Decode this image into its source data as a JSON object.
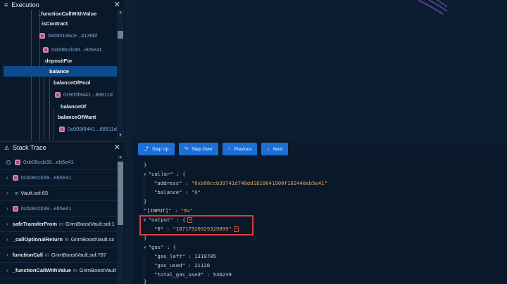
{
  "execution": {
    "title": "Execution",
    "tree": [
      {
        "label": "_functionCallWithValue",
        "type": "fn"
      },
      {
        "label": "isContract",
        "type": "fn"
      },
      {
        "label": "0x660184ce...4136bf",
        "type": "addr"
      },
      {
        "label": "0xb08ccb39...eb5e41",
        "type": "addr"
      },
      {
        "label": "depositFor",
        "type": "fn"
      },
      {
        "label": "balance",
        "type": "fn",
        "selected": true
      },
      {
        "label": "balanceOfPool",
        "type": "fn"
      },
      {
        "label": "0x905f8441...88811d",
        "type": "addr"
      },
      {
        "label": "balanceOf",
        "type": "fn"
      },
      {
        "label": "balanceOfWant",
        "type": "fn"
      },
      {
        "label": "0x905f8441...88811d",
        "type": "addr"
      }
    ]
  },
  "stack_trace": {
    "title": "Stack Trace",
    "rows": [
      {
        "addr": "0xb08ccb39...eb5e41"
      },
      {
        "addr": "0xb08ccb39...eb5e41"
      },
      {
        "in": "in",
        "file": "Vault.sol:65"
      },
      {
        "addr": "0xb08ccb39...eb5e41"
      },
      {
        "fn": "safeTransferFrom",
        "in": "in",
        "file": "GrimBoostVault.sol:1"
      },
      {
        "fn": "_callOptionalReturn",
        "in": "in",
        "file": "GrimBoostVault.sc"
      },
      {
        "fn": "functionCall",
        "in": "in",
        "file": "GrimBoostVault.sol:787"
      },
      {
        "fn": "_functionCallWithValue",
        "in": "in",
        "file": "GrimBoostVault"
      }
    ]
  },
  "toolbar": {
    "step_up": "Step Up",
    "step_over": "Step Over",
    "previous": "Previous",
    "next": "Next"
  },
  "json": {
    "line0": "}",
    "caller_key": "\"caller\"",
    "caller_open": " : {",
    "address_key": "\"address\"",
    "address_val": "\"0xb08ccb39741d746dd1818641900f182448eb5e41\"",
    "balance_key": "\"balance\"",
    "balance_val": "\"0\"",
    "close1": "}",
    "input_key": "\"[INPUT]\"",
    "input_val": "\"0x\"",
    "output_key": "\"output\"",
    "output_open": " : {",
    "out0_key": "\"0\"",
    "out0_val": "\"18717920929329899\"",
    "close2": "}",
    "gas_key": "\"gas\"",
    "gas_open": " : {",
    "gas_left_key": "\"gas_left\"",
    "gas_left_val": "1319705",
    "gas_used_key": "\"gas_used\"",
    "gas_used_val": "21120",
    "total_gas_key": "\"total_gas_used\"",
    "total_gas_val": "536239",
    "close3": "}",
    "sep": " : "
  },
  "colors": {
    "accent": "#1a6fd9",
    "selected": "#0e4a8c",
    "highlight": "#e03a3f",
    "string": "#e0a46d"
  }
}
